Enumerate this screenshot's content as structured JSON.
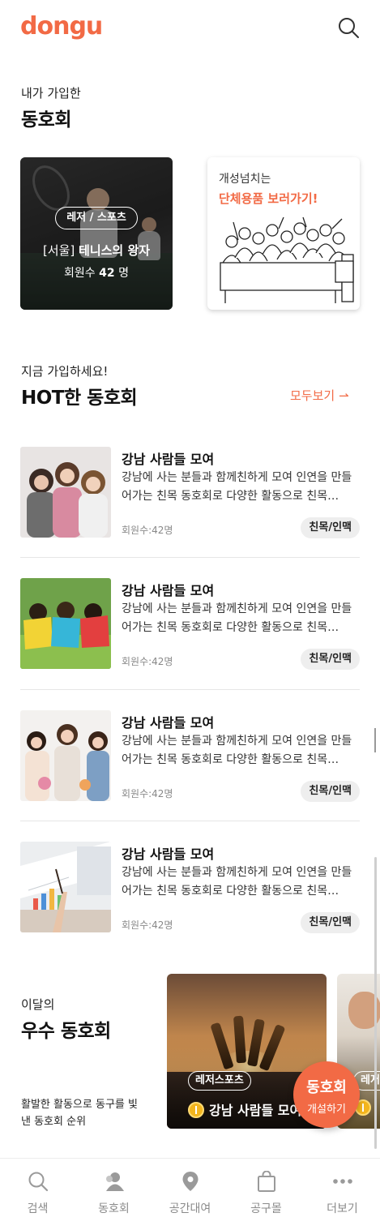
{
  "header": {
    "logo": "dongu"
  },
  "joined": {
    "subtitle": "내가 가입한",
    "title": "동호회",
    "club": {
      "category": "레저 / 스포츠",
      "region": "[서울]",
      "name": "테니스의 왕자",
      "members_label": "회원수",
      "members_count": "42",
      "members_unit": "명"
    },
    "promo": {
      "line1": "개성넘치는",
      "line2": "단체용품 보러가기!"
    }
  },
  "hot": {
    "subtitle": "지금 가입하세요!",
    "title": "HOT한 동호회",
    "see_all": "모두보기 ⇀",
    "items": [
      {
        "title": "강남 사람들 모여",
        "desc": "강남에 사는 분들과 함께친하게 모여 인연을 만들어가는 친목 동호회로 다양한 활동으로 친목…",
        "members": "회원수:42명",
        "tag": "친목/인맥"
      },
      {
        "title": "강남 사람들 모여",
        "desc": "강남에 사는 분들과 함께친하게 모여 인연을 만들어가는 친목 동호회로 다양한 활동으로 친목…",
        "members": "회원수:42명",
        "tag": "친목/인맥"
      },
      {
        "title": "강남 사람들 모여",
        "desc": "강남에 사는 분들과 함께친하게 모여 인연을 만들어가는 친목 동호회로 다양한 활동으로 친목…",
        "members": "회원수:42명",
        "tag": "친목/인맥"
      },
      {
        "title": "강남 사람들 모여",
        "desc": "강남에 사는 분들과 함께친하게 모여 인연을 만들어가는 친목 동호회로 다양한 활동으로 친목…",
        "members": "회원수:42명",
        "tag": "친목/인맥"
      }
    ]
  },
  "best": {
    "subtitle": "이달의",
    "title": "우수 동호회",
    "desc": "활발한 활동으로 동구를 빛낸 동호회 순위",
    "cards": [
      {
        "category": "레저스포츠",
        "name": "강남 사람들 모여"
      },
      {
        "category": "레저"
      }
    ]
  },
  "fab": {
    "line1": "동호회",
    "line2": "개설하기"
  },
  "tabbar": {
    "items": [
      {
        "label": "검색",
        "icon": "search-icon"
      },
      {
        "label": "동호회",
        "icon": "person-icon"
      },
      {
        "label": "공간대여",
        "icon": "location-pin-icon"
      },
      {
        "label": "공구몰",
        "icon": "shopping-bag-icon"
      },
      {
        "label": "더보기",
        "icon": "more-dots-icon"
      }
    ]
  },
  "colors": {
    "accent": "#f26a45",
    "tag_bg": "#eeeeee",
    "coin": "#f3b51e"
  }
}
